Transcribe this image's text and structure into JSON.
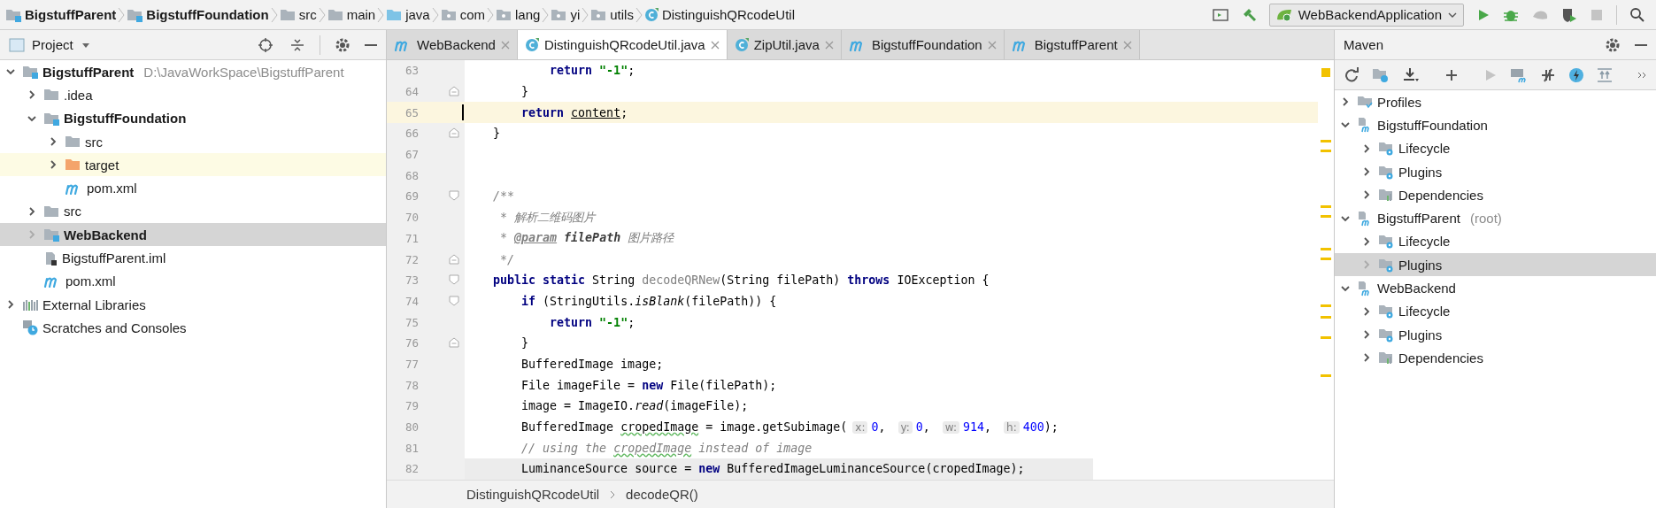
{
  "breadcrumbs": [
    {
      "label": "BigstuffParent",
      "kind": "module",
      "bold": true
    },
    {
      "label": "BigstuffFoundation",
      "kind": "module",
      "bold": true
    },
    {
      "label": "src",
      "kind": "folder",
      "bold": false
    },
    {
      "label": "main",
      "kind": "folder",
      "bold": false
    },
    {
      "label": "java",
      "kind": "source-folder",
      "bold": false
    },
    {
      "label": "com",
      "kind": "package",
      "bold": false
    },
    {
      "label": "lang",
      "kind": "package",
      "bold": false
    },
    {
      "label": "yi",
      "kind": "package",
      "bold": false
    },
    {
      "label": "utils",
      "kind": "package",
      "bold": false
    },
    {
      "label": "DistinguishQRcodeUtil",
      "kind": "class",
      "bold": false
    }
  ],
  "run_config": {
    "label": "WebBackendApplication"
  },
  "project_panel": {
    "title": "Project",
    "tree": [
      {
        "label": "BigstuffParent",
        "note": "D:\\JavaWorkSpace\\BigstuffParent",
        "kind": "module",
        "bold": true,
        "expanded": true,
        "selected": false,
        "highlighted": false,
        "children": [
          {
            "label": ".idea",
            "kind": "folder",
            "bold": false,
            "expanded": false,
            "selected": false,
            "highlighted": false
          },
          {
            "label": "BigstuffFoundation",
            "kind": "module",
            "bold": true,
            "expanded": true,
            "selected": false,
            "highlighted": false,
            "children": [
              {
                "label": "src",
                "kind": "folder",
                "bold": false,
                "expanded": false,
                "selected": false,
                "highlighted": false
              },
              {
                "label": "target",
                "kind": "excluded-folder",
                "bold": false,
                "expanded": false,
                "selected": false,
                "highlighted": true
              },
              {
                "label": "pom.xml",
                "kind": "maven-file",
                "bold": false,
                "selected": false,
                "highlighted": false
              }
            ]
          },
          {
            "label": "src",
            "kind": "folder",
            "bold": false,
            "expanded": false,
            "selected": false,
            "highlighted": false
          },
          {
            "label": "WebBackend",
            "kind": "module",
            "bold": true,
            "expanded": false,
            "selected": true,
            "highlighted": false
          },
          {
            "label": "BigstuffParent.iml",
            "kind": "iml-file",
            "bold": false,
            "selected": false,
            "highlighted": false
          },
          {
            "label": "pom.xml",
            "kind": "maven-file",
            "bold": false,
            "selected": false,
            "highlighted": false
          }
        ]
      },
      {
        "label": "External Libraries",
        "kind": "libraries",
        "bold": false,
        "expanded": false,
        "selected": false,
        "highlighted": false
      },
      {
        "label": "Scratches and Consoles",
        "kind": "scratches",
        "bold": false,
        "selected": false,
        "highlighted": false
      }
    ]
  },
  "editor": {
    "tabs": [
      {
        "label": "WebBackend",
        "kind": "maven",
        "selected": false
      },
      {
        "label": "DistinguishQRcodeUtil.java",
        "kind": "class",
        "selected": true
      },
      {
        "label": "ZipUtil.java",
        "kind": "class",
        "selected": false
      },
      {
        "label": "BigstuffFoundation",
        "kind": "maven",
        "selected": false
      },
      {
        "label": "BigstuffParent",
        "kind": "maven",
        "selected": false
      }
    ],
    "lines": [
      {
        "number": "63",
        "fold_start": false,
        "fold_end": false,
        "current": false,
        "shaded": false,
        "tokens": [
          {
            "text": "            return ",
            "kind": "kw"
          },
          {
            "text": "\"-1\"",
            "kind": "str"
          },
          {
            "text": ";",
            "kind": "plain"
          }
        ]
      },
      {
        "number": "64",
        "fold_start": false,
        "fold_end": true,
        "current": false,
        "shaded": false,
        "tokens": [
          {
            "text": "        }",
            "kind": "plain"
          }
        ]
      },
      {
        "number": "65",
        "fold_start": false,
        "fold_end": false,
        "current": true,
        "shaded": false,
        "tokens": [
          {
            "text": "        return ",
            "kind": "kw"
          },
          {
            "text": "content",
            "kind": "underlined"
          },
          {
            "text": ";",
            "kind": "plain"
          }
        ]
      },
      {
        "number": "66",
        "fold_start": false,
        "fold_end": true,
        "current": false,
        "shaded": false,
        "tokens": [
          {
            "text": "    }",
            "kind": "plain"
          }
        ]
      },
      {
        "number": "67",
        "fold_start": false,
        "fold_end": false,
        "current": false,
        "shaded": false
      },
      {
        "number": "68",
        "fold_start": false,
        "fold_end": false,
        "current": false,
        "shaded": false
      },
      {
        "number": "69",
        "fold_start": true,
        "fold_end": false,
        "current": false,
        "shaded": false,
        "tokens": [
          {
            "text": "    /**",
            "kind": "doc"
          }
        ]
      },
      {
        "number": "70",
        "fold_start": false,
        "fold_end": false,
        "current": false,
        "shaded": false,
        "tokens": [
          {
            "text": "     * 解析二维码图片",
            "kind": "doc"
          }
        ]
      },
      {
        "number": "71",
        "fold_start": false,
        "fold_end": false,
        "current": false,
        "shaded": false,
        "tokens": [
          {
            "text": "     * ",
            "kind": "doc"
          },
          {
            "text": "@param",
            "kind": "doctag"
          },
          {
            "text": " filePath",
            "kind": "docparam"
          },
          {
            "text": " 图片路径",
            "kind": "doc"
          }
        ]
      },
      {
        "number": "72",
        "fold_start": false,
        "fold_end": true,
        "current": false,
        "shaded": false,
        "tokens": [
          {
            "text": "     */",
            "kind": "doc"
          }
        ]
      },
      {
        "number": "73",
        "fold_start": true,
        "fold_end": false,
        "current": false,
        "shaded": false,
        "tokens": [
          {
            "text": "    public static ",
            "kind": "kw"
          },
          {
            "text": "String ",
            "kind": "plain"
          },
          {
            "text": "decodeQRNew",
            "kind": "unused"
          },
          {
            "text": "(String filePath) ",
            "kind": "plain"
          },
          {
            "text": "throws",
            "kind": "kw"
          },
          {
            "text": " IOException {",
            "kind": "plain"
          }
        ]
      },
      {
        "number": "74",
        "fold_start": true,
        "fold_end": false,
        "current": false,
        "shaded": false,
        "tokens": [
          {
            "text": "        if",
            "kind": "kw"
          },
          {
            "text": " (StringUtils.",
            "kind": "plain"
          },
          {
            "text": "isBlank",
            "kind": "italic"
          },
          {
            "text": "(filePath)) {",
            "kind": "plain"
          }
        ]
      },
      {
        "number": "75",
        "fold_start": false,
        "fold_end": false,
        "current": false,
        "shaded": false,
        "tokens": [
          {
            "text": "            return ",
            "kind": "kw"
          },
          {
            "text": "\"-1\"",
            "kind": "str"
          },
          {
            "text": ";",
            "kind": "plain"
          }
        ]
      },
      {
        "number": "76",
        "fold_start": false,
        "fold_end": true,
        "current": false,
        "shaded": false,
        "tokens": [
          {
            "text": "        }",
            "kind": "plain"
          }
        ]
      },
      {
        "number": "77",
        "fold_start": false,
        "fold_end": false,
        "current": false,
        "shaded": false,
        "tokens": [
          {
            "text": "        BufferedImage image;",
            "kind": "plain"
          }
        ]
      },
      {
        "number": "78",
        "fold_start": false,
        "fold_end": false,
        "current": false,
        "shaded": false,
        "tokens": [
          {
            "text": "        File imageFile = ",
            "kind": "plain"
          },
          {
            "text": "new",
            "kind": "kw"
          },
          {
            "text": " File(filePath);",
            "kind": "plain"
          }
        ]
      },
      {
        "number": "79",
        "fold_start": false,
        "fold_end": false,
        "current": false,
        "shaded": false,
        "tokens": [
          {
            "text": "        image = ImageIO.",
            "kind": "plain"
          },
          {
            "text": "read",
            "kind": "italic"
          },
          {
            "text": "(imageFile);",
            "kind": "plain"
          }
        ]
      },
      {
        "number": "80",
        "fold_start": false,
        "fold_end": false,
        "current": false,
        "shaded": false,
        "tokens": [
          {
            "text": "        BufferedImage ",
            "kind": "plain"
          },
          {
            "text": "cropedImage",
            "kind": "typo"
          },
          {
            "text": " = image.getSubimage(",
            "kind": "plain"
          },
          {
            "text": "x:",
            "kind": "hint"
          },
          {
            "text": "0",
            "kind": "num"
          },
          {
            "text": ", ",
            "kind": "plain"
          },
          {
            "text": "y:",
            "kind": "hint"
          },
          {
            "text": "0",
            "kind": "num"
          },
          {
            "text": ", ",
            "kind": "plain"
          },
          {
            "text": "w:",
            "kind": "hint"
          },
          {
            "text": "914",
            "kind": "num"
          },
          {
            "text": ", ",
            "kind": "plain"
          },
          {
            "text": "h:",
            "kind": "hint"
          },
          {
            "text": "400",
            "kind": "num"
          },
          {
            "text": ");",
            "kind": "plain"
          }
        ]
      },
      {
        "number": "81",
        "fold_start": false,
        "fold_end": false,
        "current": false,
        "shaded": false,
        "tokens": [
          {
            "text": "        // using the ",
            "kind": "comment"
          },
          {
            "text": "cropedImage",
            "kind": "comment-typo"
          },
          {
            "text": " instead of image",
            "kind": "comment"
          }
        ]
      },
      {
        "number": "82",
        "fold_start": false,
        "fold_end": false,
        "current": false,
        "shaded": true,
        "tokens": [
          {
            "text": "        LuminanceSource source = ",
            "kind": "plain"
          },
          {
            "text": "new",
            "kind": "kw"
          },
          {
            "text": " BufferedImageLuminanceSource(cropedImage);",
            "kind": "plain"
          }
        ]
      }
    ],
    "breadcrumbs": [
      "DistinguishQRcodeUtil",
      "decodeQR()"
    ]
  },
  "maven_panel": {
    "title": "Maven",
    "tree": [
      {
        "label": "Profiles",
        "kind": "profiles",
        "expanded": false,
        "selected": false
      },
      {
        "label": "BigstuffFoundation",
        "kind": "maven-module",
        "expanded": true,
        "selected": false,
        "children": [
          {
            "label": "Lifecycle",
            "kind": "lifecycle",
            "expanded": false,
            "selected": false
          },
          {
            "label": "Plugins",
            "kind": "plugins",
            "expanded": false,
            "selected": false
          },
          {
            "label": "Dependencies",
            "kind": "dependencies",
            "expanded": false,
            "selected": false
          }
        ]
      },
      {
        "label": "BigstuffParent",
        "note": "(root)",
        "kind": "maven-module",
        "expanded": true,
        "selected": false,
        "children": [
          {
            "label": "Lifecycle",
            "kind": "lifecycle",
            "expanded": false,
            "selected": false
          },
          {
            "label": "Plugins",
            "kind": "plugins",
            "expanded": false,
            "selected": true
          }
        ]
      },
      {
        "label": "WebBackend",
        "kind": "maven-module",
        "expanded": true,
        "selected": false,
        "children": [
          {
            "label": "Lifecycle",
            "kind": "lifecycle",
            "expanded": false,
            "selected": false
          },
          {
            "label": "Plugins",
            "kind": "plugins",
            "expanded": false,
            "selected": false
          },
          {
            "label": "Dependencies",
            "kind": "dependencies",
            "expanded": false,
            "selected": false
          }
        ]
      }
    ]
  }
}
